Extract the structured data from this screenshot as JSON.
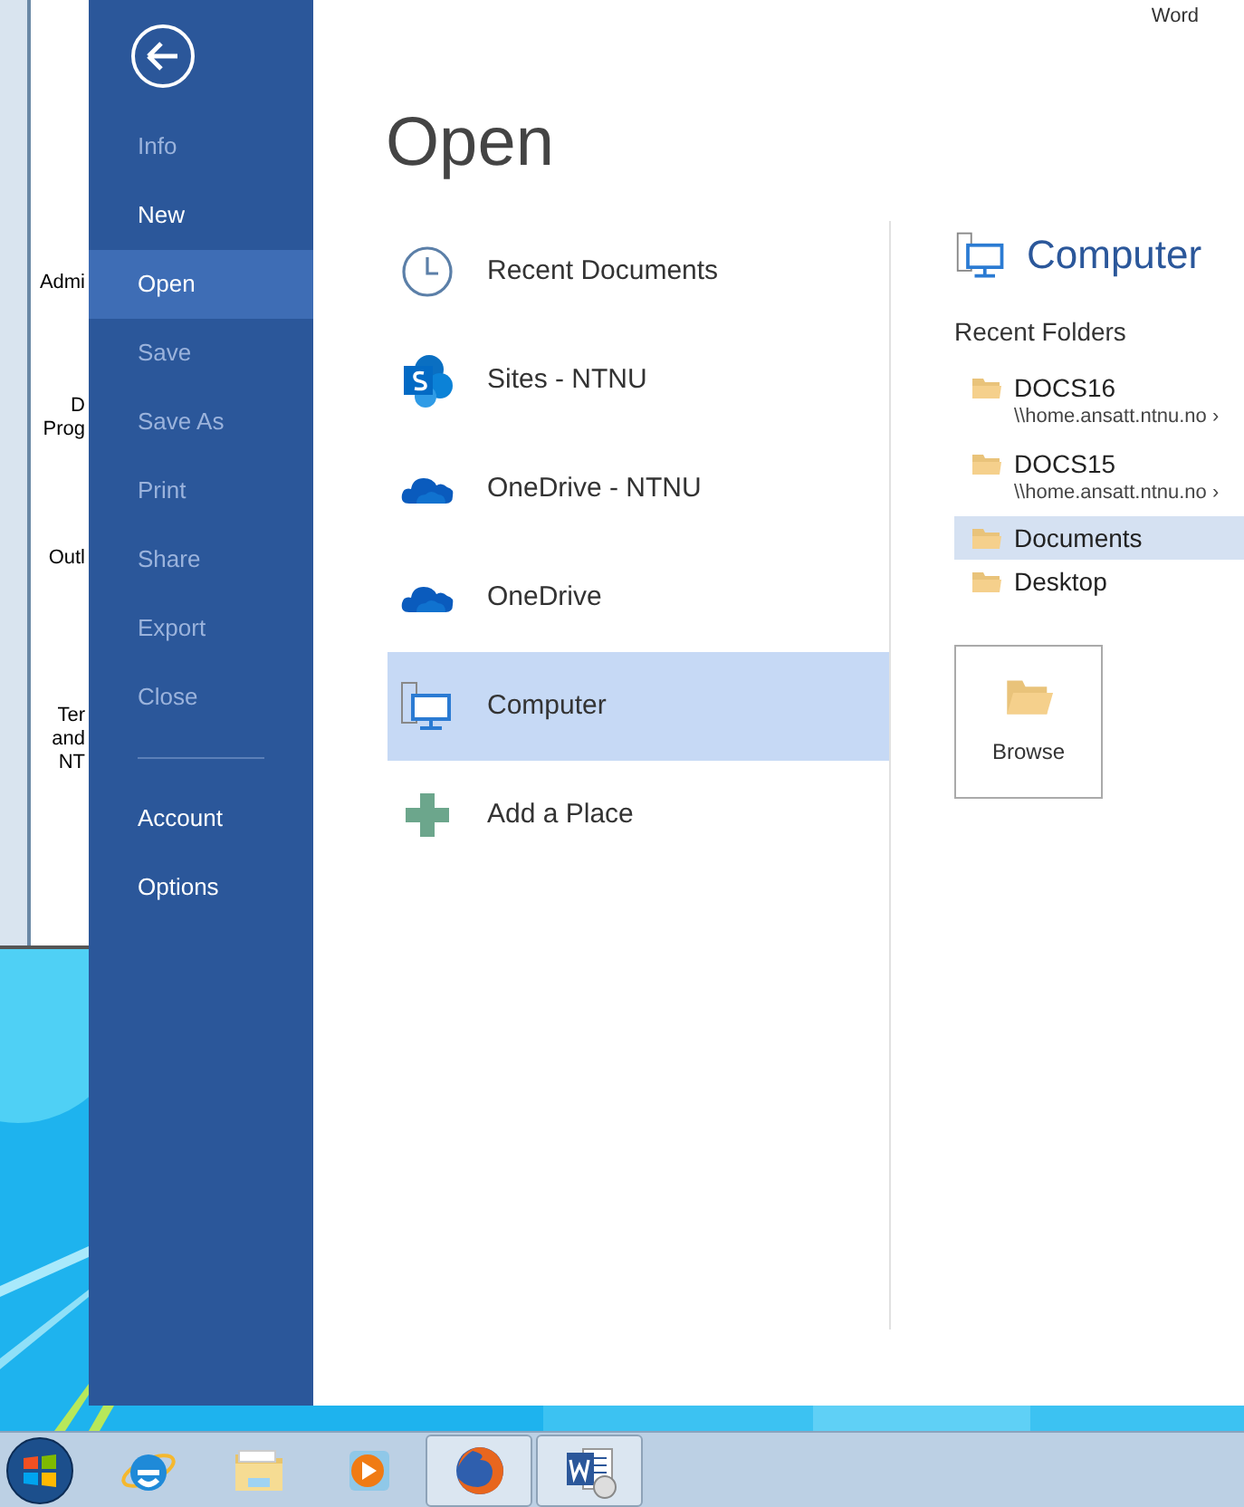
{
  "app_name": "Word",
  "background_window": {
    "labels": [
      {
        "text": "Admi"
      },
      {
        "text": "D"
      },
      {
        "text": "Prog"
      },
      {
        "text": "Outl"
      },
      {
        "text": "Ter"
      },
      {
        "text": "and"
      },
      {
        "text": "NT"
      }
    ]
  },
  "nav": {
    "items": [
      {
        "label": "Info",
        "selected": false,
        "disabled": true
      },
      {
        "label": "New",
        "selected": false,
        "disabled": false
      },
      {
        "label": "Open",
        "selected": true,
        "disabled": false
      },
      {
        "label": "Save",
        "selected": false,
        "disabled": true
      },
      {
        "label": "Save As",
        "selected": false,
        "disabled": true
      },
      {
        "label": "Print",
        "selected": false,
        "disabled": true
      },
      {
        "label": "Share",
        "selected": false,
        "disabled": true
      },
      {
        "label": "Export",
        "selected": false,
        "disabled": true
      },
      {
        "label": "Close",
        "selected": false,
        "disabled": true
      }
    ],
    "footer_items": [
      {
        "label": "Account",
        "selected": false,
        "disabled": false
      },
      {
        "label": "Options",
        "selected": false,
        "disabled": false
      }
    ]
  },
  "title": "Open",
  "places": [
    {
      "kind": "recent",
      "label": "Recent Documents",
      "selected": false
    },
    {
      "kind": "sharepoint",
      "label": "Sites - NTNU",
      "selected": false
    },
    {
      "kind": "cloud",
      "label": "OneDrive - NTNU",
      "selected": false
    },
    {
      "kind": "cloud",
      "label": "OneDrive",
      "selected": false
    },
    {
      "kind": "computer",
      "label": "Computer",
      "selected": true
    },
    {
      "kind": "add",
      "label": "Add a Place",
      "selected": false
    }
  ],
  "detail": {
    "heading": "Computer",
    "section_label": "Recent Folders",
    "folders": [
      {
        "name": "DOCS16",
        "path": "\\\\home.ansatt.ntnu.no ›",
        "selected": false
      },
      {
        "name": "DOCS15",
        "path": "\\\\home.ansatt.ntnu.no ›",
        "selected": false
      },
      {
        "name": "Documents",
        "selected": true
      },
      {
        "name": "Desktop",
        "selected": false
      }
    ],
    "browse_label": "Browse"
  },
  "taskbar": {
    "items": [
      {
        "kind": "ie",
        "running": false
      },
      {
        "kind": "explorer",
        "running": false
      },
      {
        "kind": "media",
        "running": false
      },
      {
        "kind": "firefox",
        "running": true
      },
      {
        "kind": "word",
        "running": true
      }
    ]
  }
}
